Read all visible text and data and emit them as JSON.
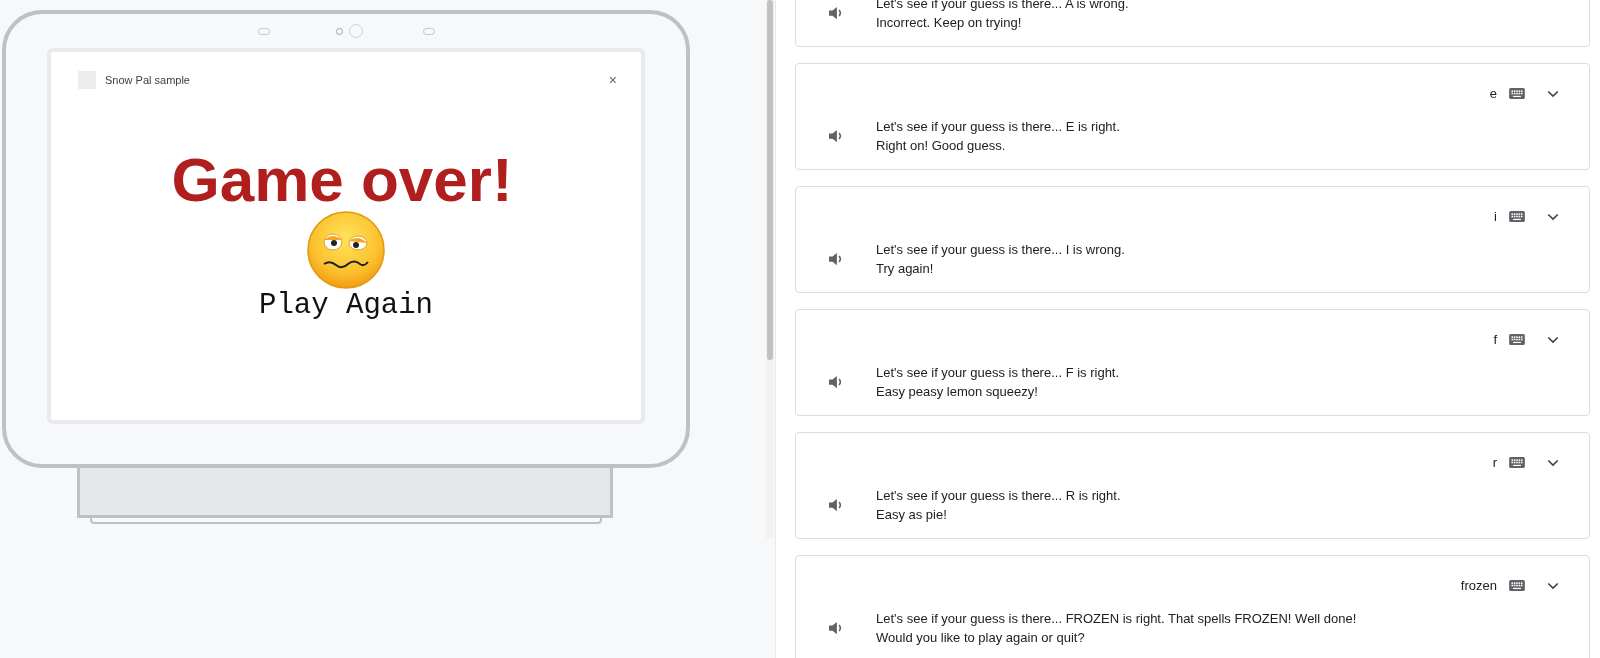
{
  "device": {
    "app_title": "Snow Pal sample",
    "close": "×",
    "headline": "Game over!",
    "button": "Play Again"
  },
  "cards": [
    {
      "lines": [
        "Let's see if your guess is there... A is wrong.",
        "Incorrect. Keep on trying!"
      ]
    },
    {
      "query": "e",
      "lines": [
        "Let's see if your guess is there... E is right.",
        "Right on! Good guess."
      ]
    },
    {
      "query": "i",
      "lines": [
        "Let's see if your guess is there... I is wrong.",
        "Try again!"
      ]
    },
    {
      "query": "f",
      "lines": [
        "Let's see if your guess is there... F is right.",
        "Easy peasy lemon squeezy!"
      ]
    },
    {
      "query": "r",
      "lines": [
        "Let's see if your guess is there... R is right.",
        "Easy as pie!"
      ]
    },
    {
      "query": "frozen",
      "lines": [
        "Let's see if your guess is there... FROZEN is right. That spells FROZEN! Well done!",
        "Would you like to play again or quit?"
      ]
    }
  ]
}
